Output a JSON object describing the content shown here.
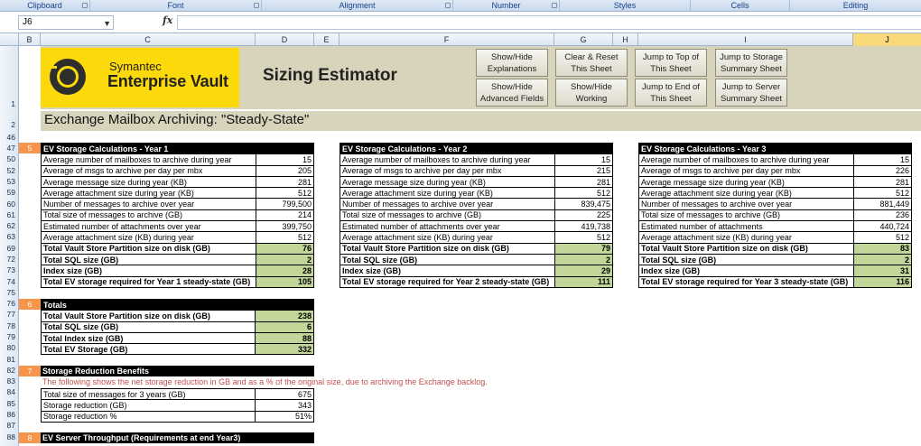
{
  "ribbon": {
    "groups": [
      "Clipboard",
      "Font",
      "Alignment",
      "Number",
      "Styles",
      "Cells",
      "Editing"
    ]
  },
  "formula_bar": {
    "name_box": "J6",
    "fx": "fx",
    "formula": ""
  },
  "columns": [
    "B",
    "C",
    "D",
    "E",
    "F",
    "G",
    "H",
    "I",
    "J"
  ],
  "rows": [
    "1",
    "2",
    "46",
    "47",
    "50",
    "52",
    "53",
    "59",
    "60",
    "61",
    "62",
    "63",
    "69",
    "72",
    "73",
    "74",
    "75",
    "76",
    "77",
    "78",
    "79",
    "80",
    "81",
    "82",
    "83",
    "84",
    "85",
    "86",
    "87",
    "88"
  ],
  "logo": {
    "tiny": "Symantec",
    "big": "Enterprise Vault"
  },
  "title": "Sizing Estimator",
  "buttons": {
    "show_hide_explanations": "Show/Hide Explanations",
    "show_hide_advanced": "Show/Hide Advanced Fields",
    "clear_reset": "Clear & Reset This Sheet",
    "show_hide_working": "Show/Hide Working",
    "jump_top": "Jump to Top of This Sheet",
    "jump_end": "Jump to End of This Sheet",
    "jump_storage": "Jump to Storage Summary Sheet",
    "jump_server": "Jump to Server Summary Sheet"
  },
  "subtitle": "Exchange Mailbox Archiving: \"Steady-State\"",
  "sections": {
    "s5": "5",
    "s6": "6",
    "s7": "7",
    "s8": "8"
  },
  "year_tables": [
    {
      "title": "EV Storage Calculations - Year 1",
      "rows": [
        {
          "label": "Average number of mailboxes to archive during year",
          "value": "15"
        },
        {
          "label": "Average of msgs to archive per day per mbx",
          "value": "205"
        },
        {
          "label": "Average message size during year (KB)",
          "value": "281"
        },
        {
          "label": "Average attachment size during year (KB)",
          "value": "512"
        },
        {
          "label": "Number of messages to archive over year",
          "value": "799,500"
        },
        {
          "label": "Total size of messages to archive (GB)",
          "value": "214"
        },
        {
          "label": "Estimated number of attachments over year",
          "value": "399,750"
        },
        {
          "label": "Average attachment size (KB) during year",
          "value": "512"
        },
        {
          "label": "Total Vault Store Partition size on disk (GB)",
          "value": "76",
          "bold": true
        },
        {
          "label": "Total SQL size (GB)",
          "value": "2",
          "bold": true
        },
        {
          "label": "Index size (GB)",
          "value": "28",
          "bold": true
        },
        {
          "label": "Total EV storage required for Year 1 steady-state (GB)",
          "value": "105",
          "bold": true
        }
      ]
    },
    {
      "title": "EV Storage Calculations - Year 2",
      "rows": [
        {
          "label": "Average number of mailboxes to archive during year",
          "value": "15"
        },
        {
          "label": "Average of msgs to archive per day per mbx",
          "value": "215"
        },
        {
          "label": "Average message size during year (KB)",
          "value": "281"
        },
        {
          "label": "Average attachment size during year (KB)",
          "value": "512"
        },
        {
          "label": "Number of messages to archive over year",
          "value": "839,475"
        },
        {
          "label": "Total size of messages to archive (GB)",
          "value": "225"
        },
        {
          "label": "Estimated number of attachments over year",
          "value": "419,738"
        },
        {
          "label": "Average attachment size (KB) during year",
          "value": "512"
        },
        {
          "label": "Total Vault Store Partition size on disk (GB)",
          "value": "79",
          "bold": true
        },
        {
          "label": "Total SQL size (GB)",
          "value": "2",
          "bold": true
        },
        {
          "label": "Index size (GB)",
          "value": "29",
          "bold": true
        },
        {
          "label": "Total EV storage required for Year 2 steady-state (GB)",
          "value": "111",
          "bold": true
        }
      ]
    },
    {
      "title": "EV Storage Calculations - Year 3",
      "rows": [
        {
          "label": "Average number of mailboxes to archive during year",
          "value": "15"
        },
        {
          "label": "Average of msgs to archive per day per mbx",
          "value": "226"
        },
        {
          "label": "Average message size during year (KB)",
          "value": "281"
        },
        {
          "label": "Average attachment size during year (KB)",
          "value": "512"
        },
        {
          "label": "Number of messages to archive over year",
          "value": "881,449"
        },
        {
          "label": "Total size of messages to archive (GB)",
          "value": "236"
        },
        {
          "label": "Estimated number of attachments",
          "value": "440,724"
        },
        {
          "label": "Average attachment size (KB) during year",
          "value": "512"
        },
        {
          "label": "Total Vault Store Partition size on disk (GB)",
          "value": "83",
          "bold": true
        },
        {
          "label": "Total SQL size (GB)",
          "value": "2",
          "bold": true
        },
        {
          "label": "Index size (GB)",
          "value": "31",
          "bold": true
        },
        {
          "label": "Total EV storage required for Year 3 steady-state (GB)",
          "value": "116",
          "bold": true
        }
      ]
    }
  ],
  "totals": {
    "title": "Totals",
    "rows": [
      {
        "label": "Total Vault Store Partition size on disk (GB)",
        "value": "238"
      },
      {
        "label": "Total SQL size (GB)",
        "value": "6"
      },
      {
        "label": "Total Index size (GB)",
        "value": "88"
      },
      {
        "label": "Total EV Storage (GB)",
        "value": "332"
      }
    ]
  },
  "reduction": {
    "title": "Storage Reduction Benefits",
    "note": "The following shows the net storage reduction in GB and as a % of the original size, due to archiving the Exchange backlog.",
    "rows": [
      {
        "label": "Total size of messages for 3 years (GB)",
        "value": "675"
      },
      {
        "label": "Storage reduction (GB)",
        "value": "343"
      },
      {
        "label": "Storage reduction %",
        "value": "51%"
      }
    ]
  },
  "throughput": {
    "title": "EV Server Throughput (Requirements at end Year3)"
  },
  "colors": {
    "banner": "#d8d4bc",
    "logo_yellow": "#fcd90a",
    "section_orange": "#f7964a",
    "total_green": "#c2d69a",
    "note_red": "#c0504d"
  }
}
